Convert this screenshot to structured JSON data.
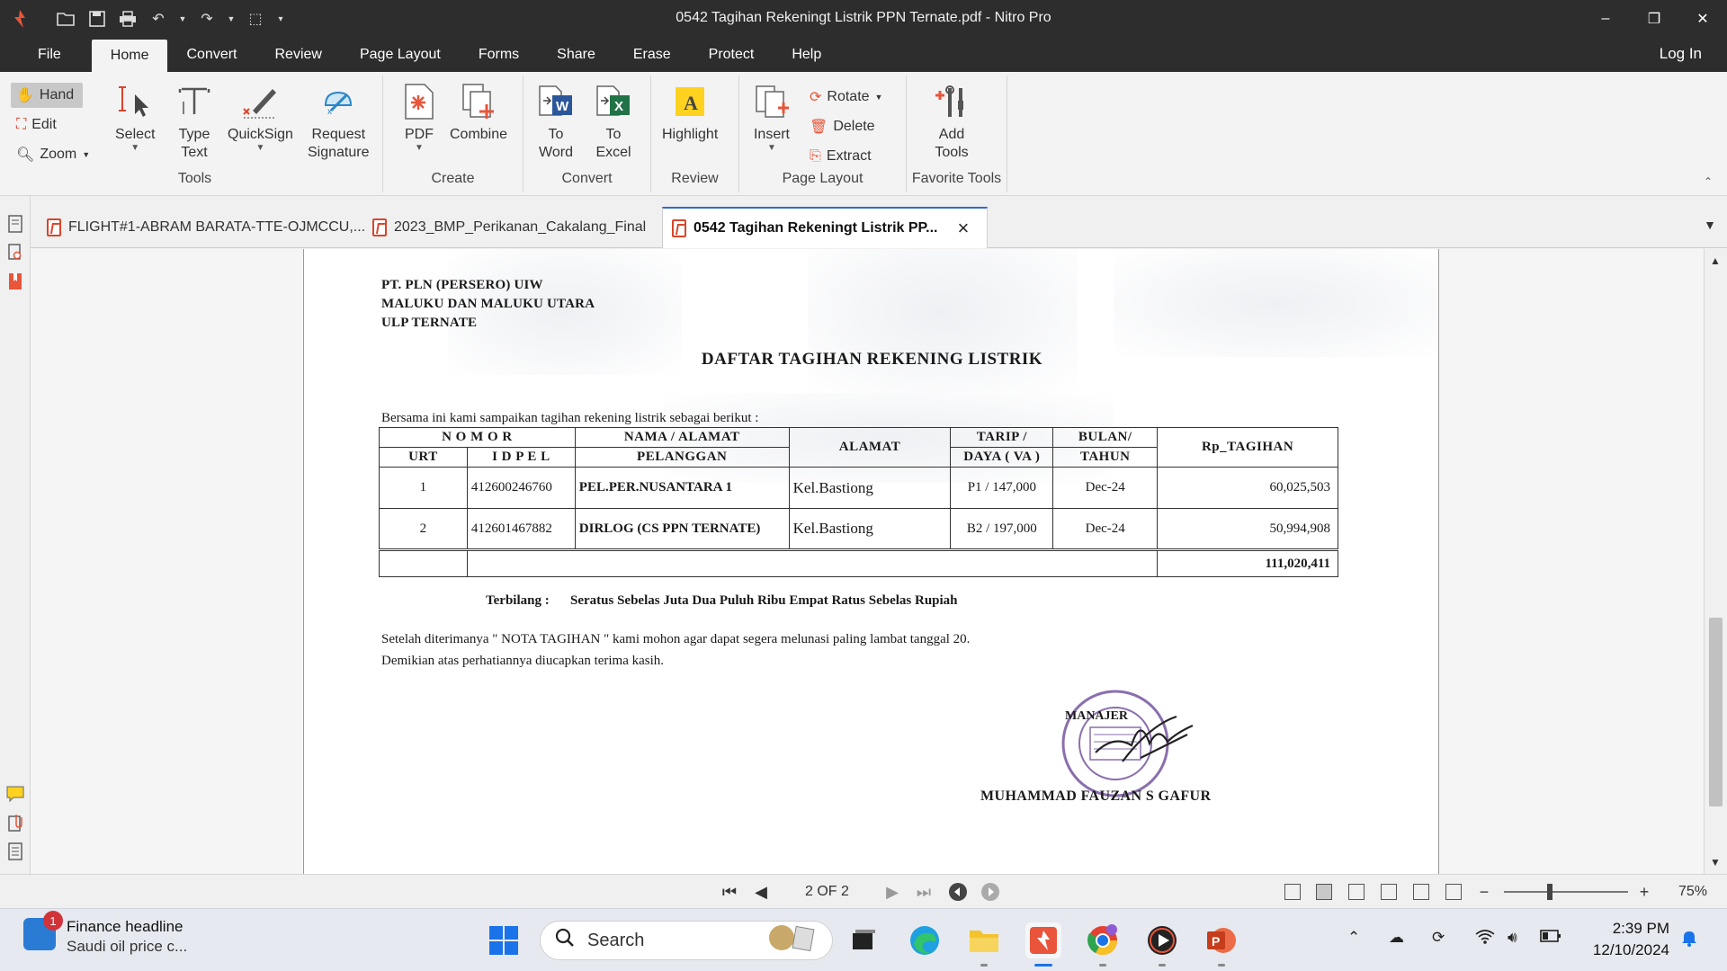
{
  "window": {
    "title": "0542 Tagihan Rekeningt Listrik PPN Ternate.pdf - Nitro Pro",
    "minimize": "–",
    "restore": "❐",
    "close": "✕"
  },
  "menu": {
    "file": "File",
    "tabs": [
      "Home",
      "Convert",
      "Review",
      "Page Layout",
      "Forms",
      "Share",
      "Erase",
      "Protect",
      "Help"
    ],
    "login": "Log In"
  },
  "ribbon": {
    "tools": {
      "hand": "Hand",
      "edit": "Edit",
      "zoom": "Zoom",
      "select": "Select",
      "type_text": [
        "Type",
        "Text"
      ],
      "quicksign": "QuickSign",
      "request_signature": [
        "Request",
        "Signature"
      ],
      "label": "Tools"
    },
    "create": {
      "pdf": "PDF",
      "combine": "Combine",
      "label": "Create"
    },
    "convert": {
      "to_word": [
        "To",
        "Word"
      ],
      "to_excel": [
        "To",
        "Excel"
      ],
      "label": "Convert"
    },
    "review": {
      "highlight": "Highlight",
      "label": "Review"
    },
    "page_layout": {
      "insert": "Insert",
      "rotate": "Rotate",
      "delete": "Delete",
      "extract": "Extract",
      "label": "Page Layout"
    },
    "favorite": {
      "add_tools": [
        "Add",
        "Tools"
      ],
      "label": "Favorite Tools"
    }
  },
  "doc_tabs": [
    {
      "label": "FLIGHT#1-ABRAM BARATA-TTE-OJMCCU,..."
    },
    {
      "label": "2023_BMP_Perikanan_Cakalang_Final"
    },
    {
      "label": "0542 Tagihan Rekeningt Listrik PP..."
    }
  ],
  "document": {
    "header": [
      "PT. PLN (PERSERO) UIW",
      "MALUKU DAN MALUKU UTARA",
      "ULP TERNATE"
    ],
    "title": "DAFTAR TAGIHAN REKENING LISTRIK",
    "intro": "Bersama ini kami sampaikan  tagihan rekening  listrik sebagai berikut :",
    "table": {
      "h_nomor": "N O M O R",
      "h_nama": "NAMA / ALAMAT",
      "h_pelanggan": "PELANGGAN",
      "h_alamat": "ALAMAT",
      "h_tarip": "TARIP /",
      "h_daya": "DAYA ( VA )",
      "h_bulan": "BULAN/",
      "h_tahun": "TAHUN",
      "h_tagihan": "Rp_TAGIHAN",
      "h_urt": "URT",
      "h_idpel": "I D P E L",
      "rows": [
        {
          "urt": "1",
          "idpel": "412600246760",
          "nama": "PEL.PER.NUSANTARA 1",
          "alamat": "Kel.Bastiong",
          "tarip": "P1 / 147,000",
          "bulan": "Dec-24",
          "tagihan": "60,025,503"
        },
        {
          "urt": "2",
          "idpel": "412601467882",
          "nama": "DIRLOG (CS PPN TERNATE)",
          "alamat": "Kel.Bastiong",
          "tarip": "B2 / 197,000",
          "bulan": "Dec-24",
          "tagihan": "50,994,908"
        }
      ],
      "total": "111,020,411"
    },
    "terbilang_label": "Terbilang :",
    "terbilang_value": "Seratus Sebelas Juta  Dua Puluh Ribu Empat Ratus Sebelas Rupiah",
    "closing1": "Setelah diterimanya \" NOTA TAGIHAN \" kami mohon agar dapat segera melunasi paling lambat tanggal 20.",
    "closing2": "Demikian atas perhatiannya diucapkan terima kasih.",
    "manajer": "MANAJER",
    "signer": "MUHAMMAD FAUZAN S GAFUR"
  },
  "statusbar": {
    "page": "2 OF 2",
    "zoom": "75%",
    "zoom_level_percent": 75
  },
  "taskbar": {
    "news_title": "Finance headline",
    "news_sub": "Saudi oil price c...",
    "news_badge": "1",
    "search": "Search",
    "time": "2:39 PM",
    "date": "12/10/2024"
  },
  "colors": {
    "titlebar": "#2d2d2d",
    "accent": "#2e6bd6",
    "nitro_red": "#d9452b"
  }
}
